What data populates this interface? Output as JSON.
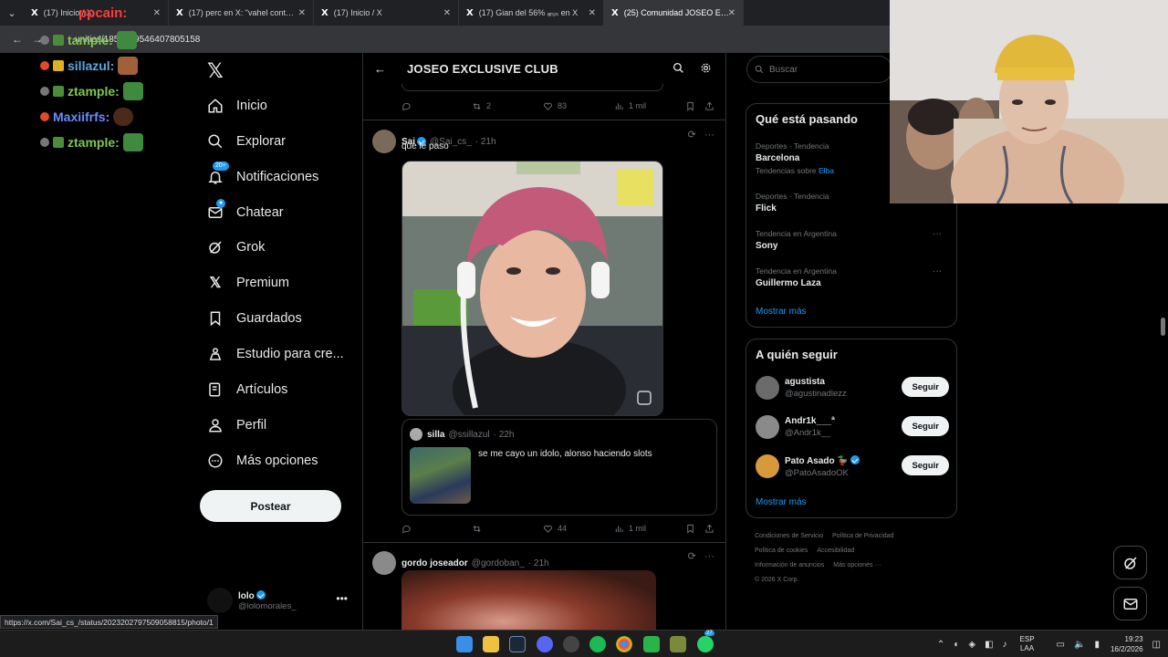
{
  "browser": {
    "tabs": [
      {
        "label": "(17) Inicio / X"
      },
      {
        "label": "(17) perc en X: \"vahel contra 3"
      },
      {
        "label": "(17) Inicio / X"
      },
      {
        "label": "(17) Gian del 56% ₐᵣᵤₛ en X"
      },
      {
        "label": "(25) Comunidad JOSEO EXCLUS"
      }
    ],
    "url": "unities/1851039546407805158"
  },
  "overlay_chat": [
    {
      "name": "tample:",
      "color": "#7ec850"
    },
    {
      "name": "sillazul:",
      "color": "#5aa8e0"
    },
    {
      "name": "ztample:",
      "color": "#7ec850"
    },
    {
      "name": "Maxiifrfs:",
      "color": "#6a8cff"
    },
    {
      "name": "ztample:",
      "color": "#7ec850"
    }
  ],
  "overlay_top": "ppcain:",
  "nav": {
    "items": [
      {
        "label": "Inicio",
        "icon": "home-icon"
      },
      {
        "label": "Explorar",
        "icon": "search-icon"
      },
      {
        "label": "Notificaciones",
        "icon": "bell-icon",
        "badge": "20+"
      },
      {
        "label": "Chatear",
        "icon": "mail-icon"
      },
      {
        "label": "Grok",
        "icon": "grok-icon"
      },
      {
        "label": "Premium",
        "icon": "x-icon"
      },
      {
        "label": "Guardados",
        "icon": "bookmark-icon"
      },
      {
        "label": "Estudio para cre...",
        "icon": "studio-icon"
      },
      {
        "label": "Artículos",
        "icon": "article-icon"
      },
      {
        "label": "Perfil",
        "icon": "person-icon"
      },
      {
        "label": "Más opciones",
        "icon": "more-circle-icon"
      }
    ],
    "post_label": "Postear",
    "account": {
      "name": "lolo",
      "handle": "@lolomorales_"
    }
  },
  "center": {
    "title": "JOSEO EXCLUSIVE CLUB",
    "prev_actions": {
      "retweets": "2",
      "likes": "83",
      "views": "1 mil"
    },
    "tweet": {
      "name": "Sai",
      "handle": "@Sai_cs_",
      "time": "· 21h",
      "text": "que le paso",
      "quote": {
        "name": "silla",
        "handle": "@ssillazul",
        "time": "· 22h",
        "text": "se me cayo un idolo, alonso haciendo slots"
      },
      "actions": {
        "retweets": "",
        "likes": "44",
        "views": "1 mil"
      }
    },
    "next_tweet": {
      "name": "gordo joseador",
      "handle": "@gordoban_",
      "time": "· 21h"
    }
  },
  "right": {
    "search_placeholder": "Buscar",
    "trends_title": "Qué está pasando",
    "trends": [
      {
        "context": "Deportes · Tendencia",
        "name": "Barcelona",
        "sub": "Tendencias sobre ",
        "sub_link": "Elba"
      },
      {
        "context": "Deportes · Tendencia",
        "name": "Flick"
      },
      {
        "context": "Tendencia en Argentina",
        "name": "Sony"
      },
      {
        "context": "Tendencia en Argentina",
        "name": "Guillermo Laza"
      }
    ],
    "show_more": "Mostrar más",
    "follow_title": "A quién seguir",
    "follow": [
      {
        "name": "agustista",
        "handle": "@agustinadlezz",
        "button": "Seguir",
        "avatar_color": "#6b6b6b"
      },
      {
        "name": "Andr1k___ª",
        "handle": "@Andr1k__",
        "button": "Seguir",
        "avatar_color": "#8a8a8a"
      },
      {
        "name": "Pato Asado 🦆",
        "handle": "@PatoAsadoOK",
        "button": "Seguir",
        "avatar_color": "#d79a3a"
      }
    ],
    "follow_more": "Mostrar más",
    "footer": [
      "Condiciones de Servicio",
      "Política de Privacidad",
      "Política de cookies",
      "Accesibilidad",
      "Información de anuncios",
      "Más opciones ···",
      "© 2026 X Corp."
    ]
  },
  "statusbar": "https://x.com/Sai_cs_/status/2023202797509058815/photo/1",
  "taskbar": {
    "lang_top": "ESP",
    "lang_bottom": "LAA",
    "time": "19:23",
    "date": "16/2/2026",
    "badge": "27"
  }
}
